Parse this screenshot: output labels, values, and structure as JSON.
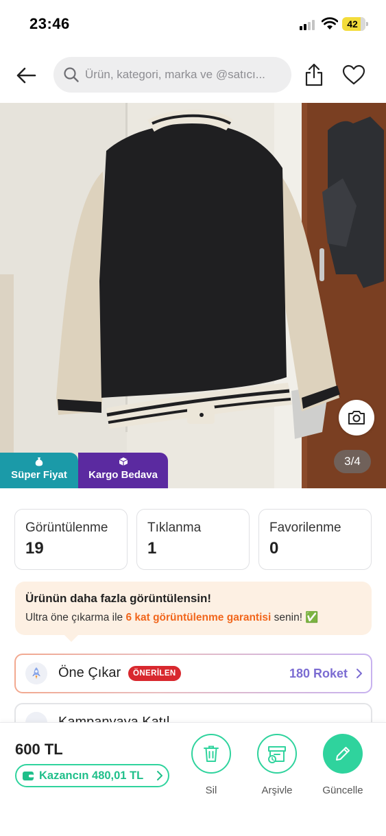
{
  "status_bar": {
    "time": "23:46",
    "battery_level": "42"
  },
  "search": {
    "placeholder": "Ürün, kategori, marka ve @satıcı..."
  },
  "gallery": {
    "counter": "3/4",
    "badges": [
      {
        "label": "Süper Fiyat",
        "color": "#1b9aa8"
      },
      {
        "label": "Kargo Bedava",
        "color": "#5b2aa0"
      }
    ]
  },
  "stats": [
    {
      "label": "Görüntülenme",
      "value": "19"
    },
    {
      "label": "Tıklanma",
      "value": "1"
    },
    {
      "label": "Favorilenme",
      "value": "0"
    }
  ],
  "promo": {
    "title": "Ürünün daha fazla görüntülensin!",
    "text_before": "Ultra öne çıkarma ile ",
    "highlight": "6 kat görüntülenme garantisi",
    "text_after": " senin! ✅"
  },
  "boost": {
    "title": "Öne Çıkar",
    "badge": "ÖNERİLEN",
    "price": "180 Roket"
  },
  "campaign": {
    "title": "Kampanyaya Katıl"
  },
  "bottom_bar": {
    "price": "600 TL",
    "earnings": "Kazancın 480,01 TL",
    "actions": [
      {
        "label": "Sil"
      },
      {
        "label": "Arşivle"
      },
      {
        "label": "Güncelle"
      }
    ]
  },
  "colors": {
    "accent": "#2fd39d",
    "highlight_orange": "#f1661c",
    "badge_red": "#d8282e",
    "roket_purple": "#7b6cd2"
  }
}
